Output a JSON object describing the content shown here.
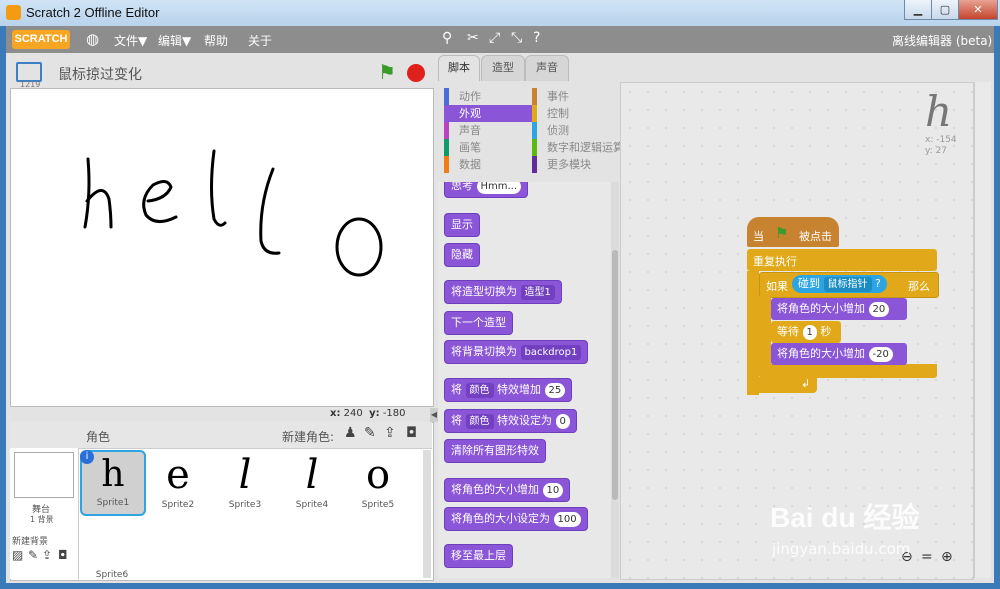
{
  "window": {
    "title": "Scratch 2 Offline Editor",
    "min": "▁",
    "max": "▢",
    "close": "✕"
  },
  "menubar": {
    "logo": "SCRATCH",
    "file": "文件▼",
    "edit": "编辑▼",
    "help": "帮助",
    "about": "关于",
    "edition": "离线编辑器 (beta)"
  },
  "stage": {
    "title": "鼠标掠过变化",
    "version": "1219",
    "canvas_text": [
      "h",
      "e",
      "l",
      "l",
      "o"
    ],
    "x_label": "x:",
    "x_val": "240",
    "y_label": "y:",
    "y_val": "-180"
  },
  "sprites": {
    "header": "角色",
    "new_sprite": "新建角色:",
    "stage_label": "舞台",
    "backdrop_count": "1 背景",
    "new_backdrop": "新建背景",
    "list": [
      {
        "name": "Sprite1",
        "glyph": "h"
      },
      {
        "name": "Sprite2",
        "glyph": "e"
      },
      {
        "name": "Sprite3",
        "glyph": "l"
      },
      {
        "name": "Sprite4",
        "glyph": "l"
      },
      {
        "name": "Sprite5",
        "glyph": "o"
      },
      {
        "name": "Sprite6",
        "glyph": ""
      }
    ]
  },
  "tabs": {
    "scripts": "脚本",
    "costumes": "造型",
    "sounds": "声音"
  },
  "categories": {
    "motion": "动作",
    "looks": "外观",
    "sound": "声音",
    "pen": "画笔",
    "data": "数据",
    "events": "事件",
    "control": "控制",
    "sensing": "侦测",
    "operators": "数字和逻辑运算",
    "more": "更多模块"
  },
  "palette": {
    "think": "思考",
    "think_val": "Hmm...",
    "show": "显示",
    "hide": "隐藏",
    "switch_costume": "将造型切换为",
    "costume_val": "造型1",
    "next_costume": "下一个造型",
    "switch_backdrop": "将背景切换为",
    "backdrop_val": "backdrop1",
    "change_effect_pre": "将",
    "effect_val": "颜色",
    "change_effect_post": "特效增加",
    "change_effect_num": "25",
    "set_effect_pre": "将",
    "set_effect_post": "特效设定为",
    "set_effect_num": "0",
    "clear_effects": "清除所有图形特效",
    "change_size": "将角色的大小增加",
    "change_size_num": "10",
    "set_size": "将角色的大小设定为",
    "set_size_num": "100",
    "front": "移至最上层"
  },
  "script": {
    "when": "当",
    "clicked": "被点击",
    "forever": "重复执行",
    "if": "如果",
    "touching": "碰到",
    "touch_target": "鼠标指针",
    "q": "?",
    "then": "那么",
    "grow": "将角色的大小增加",
    "grow_num": "20",
    "wait": "等待",
    "wait_num": "1",
    "seconds": "秒",
    "shrink": "将角色的大小增加",
    "shrink_num": "-20",
    "sprite_glyph": "h",
    "sx": "x: -154",
    "sy": "y: 27"
  },
  "watermark": {
    "brand": "Bai du 经验",
    "url": "jingyan.baidu.com"
  },
  "colors": {
    "looks": "#8a55d7",
    "events": "#c88330",
    "control": "#e1a91a",
    "sensing": "#2ca5e2",
    "sel": "#8a55d7"
  }
}
